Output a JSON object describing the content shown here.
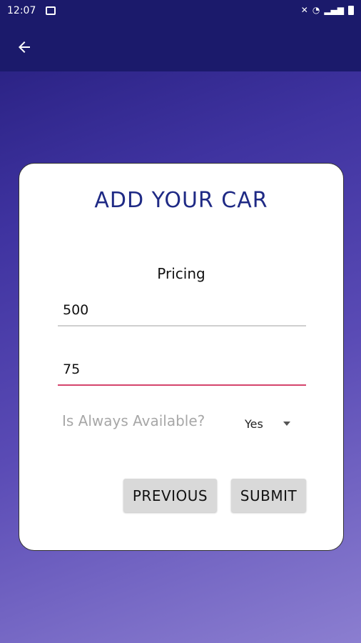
{
  "status_bar": {
    "time": "12:07"
  },
  "app_bar": {
    "back_icon": "back-arrow-icon"
  },
  "form": {
    "title": "ADD YOUR CAR",
    "section_label": "Pricing",
    "field1_value": "500",
    "field2_value": "75",
    "availability_label": "Is Always Available?",
    "availability_selected": "Yes",
    "previous_label": "PREVIOUS",
    "submit_label": "SUBMIT"
  },
  "colors": {
    "app_bar": "#1b1a6b",
    "title": "#1f2a85",
    "active_underline": "#d5446c"
  }
}
